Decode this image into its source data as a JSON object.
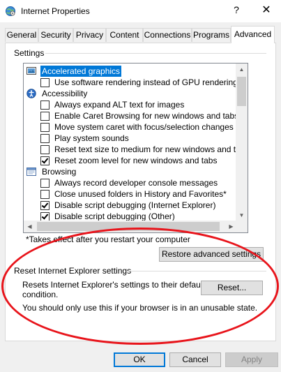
{
  "window": {
    "title": "Internet Properties",
    "help_glyph": "?",
    "close_glyph": "✕"
  },
  "tabs": [
    {
      "label": "General"
    },
    {
      "label": "Security"
    },
    {
      "label": "Privacy"
    },
    {
      "label": "Content"
    },
    {
      "label": "Connections"
    },
    {
      "label": "Programs"
    },
    {
      "label": "Advanced",
      "active": true
    }
  ],
  "settings": {
    "group_label": "Settings",
    "items": [
      {
        "kind": "category",
        "icon": "monitor-icon",
        "label": "Accelerated graphics",
        "selected": true
      },
      {
        "kind": "option",
        "label": "Use software rendering instead of GPU rendering*",
        "checked": false
      },
      {
        "kind": "category",
        "icon": "accessibility-icon",
        "label": "Accessibility"
      },
      {
        "kind": "option",
        "label": "Always expand ALT text for images",
        "checked": false
      },
      {
        "kind": "option",
        "label": "Enable Caret Browsing for new windows and tabs",
        "checked": false
      },
      {
        "kind": "option",
        "label": "Move system caret with focus/selection changes",
        "checked": false
      },
      {
        "kind": "option",
        "label": "Play system sounds",
        "checked": false
      },
      {
        "kind": "option",
        "label": "Reset text size to medium for new windows and tabs",
        "checked": false
      },
      {
        "kind": "option",
        "label": "Reset zoom level for new windows and tabs",
        "checked": true
      },
      {
        "kind": "category",
        "icon": "browsing-icon",
        "label": "Browsing"
      },
      {
        "kind": "option",
        "label": "Always record developer console messages",
        "checked": false
      },
      {
        "kind": "option",
        "label": "Close unused folders in History and Favorites*",
        "checked": false
      },
      {
        "kind": "option",
        "label": "Disable script debugging (Internet Explorer)",
        "checked": true
      },
      {
        "kind": "option",
        "label": "Disable script debugging (Other)",
        "checked": true
      }
    ],
    "footnote": "*Takes effect after you restart your computer",
    "restore_button": "Restore advanced settings"
  },
  "reset": {
    "group_label": "Reset Internet Explorer settings",
    "description": "Resets Internet Explorer's settings to their default condition.",
    "description_line1": "Resets Internet Explorer's settings to their default",
    "description_line2": "condition.",
    "button": "Reset...",
    "warning": "You should only use this if your browser is in an unusable state."
  },
  "dialog_buttons": {
    "ok": "OK",
    "cancel": "Cancel",
    "apply": "Apply"
  },
  "colors": {
    "selection": "#0078d7",
    "annotation": "#e8141b",
    "primary_border": "#0078d7"
  }
}
